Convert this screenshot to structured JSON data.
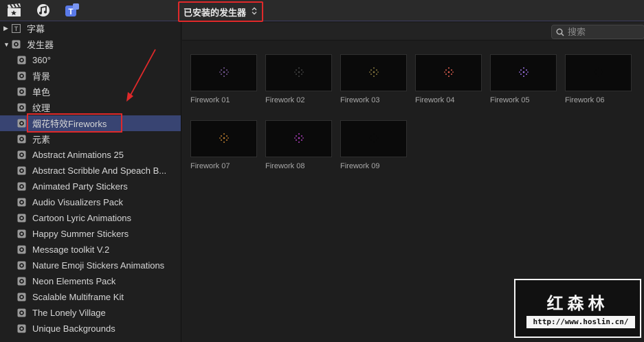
{
  "toolbar": {
    "icons": [
      "clapperboard-icon",
      "music-icon",
      "titles-generators-icon"
    ],
    "generator_dropdown": {
      "label": "已安装的发生器",
      "chevron": "⌃⌄"
    }
  },
  "search": {
    "placeholder": "搜索"
  },
  "sidebar": {
    "sections": [
      {
        "label": "字幕",
        "expanded": false
      },
      {
        "label": "发生器",
        "expanded": true
      }
    ],
    "items": [
      {
        "label": "360°"
      },
      {
        "label": "背景"
      },
      {
        "label": "单色"
      },
      {
        "label": "纹理"
      },
      {
        "label": "烟花特效Fireworks",
        "selected": true
      },
      {
        "label": "元素"
      },
      {
        "label": "Abstract Animations 25"
      },
      {
        "label": "Abstract Scribble And Speach B..."
      },
      {
        "label": "Animated Party Stickers"
      },
      {
        "label": "Audio Visualizers Pack"
      },
      {
        "label": "Cartoon Lyric Animations"
      },
      {
        "label": "Happy Summer Stickers"
      },
      {
        "label": "Message toolkit V.2"
      },
      {
        "label": "Nature Emoji Stickers Animations"
      },
      {
        "label": "Neon Elements Pack"
      },
      {
        "label": "Scalable Multiframe Kit"
      },
      {
        "label": "The Lonely Village"
      },
      {
        "label": "Unique Backgrounds"
      }
    ]
  },
  "browser": {
    "clips": [
      {
        "label": "Firework 01",
        "spark_color": "#7a5a9a"
      },
      {
        "label": "Firework 02",
        "spark_color": "#444444"
      },
      {
        "label": "Firework 03",
        "spark_color": "#8a7a40"
      },
      {
        "label": "Firework 04",
        "spark_color": "#e06050"
      },
      {
        "label": "Firework 05",
        "spark_color": "#9a70e0"
      },
      {
        "label": "Firework 06",
        "spark_color": "#0a0a0a"
      },
      {
        "label": "Firework 07",
        "spark_color": "#c08030"
      },
      {
        "label": "Firework 08",
        "spark_color": "#b040c0"
      },
      {
        "label": "Firework 09",
        "spark_color": "#0a0a0a"
      }
    ]
  },
  "watermark": {
    "logo": "红森林",
    "url": "http://www.hoslin.cn/"
  },
  "colors": {
    "accent_selection": "#384472",
    "highlight_box": "#e0292a"
  }
}
